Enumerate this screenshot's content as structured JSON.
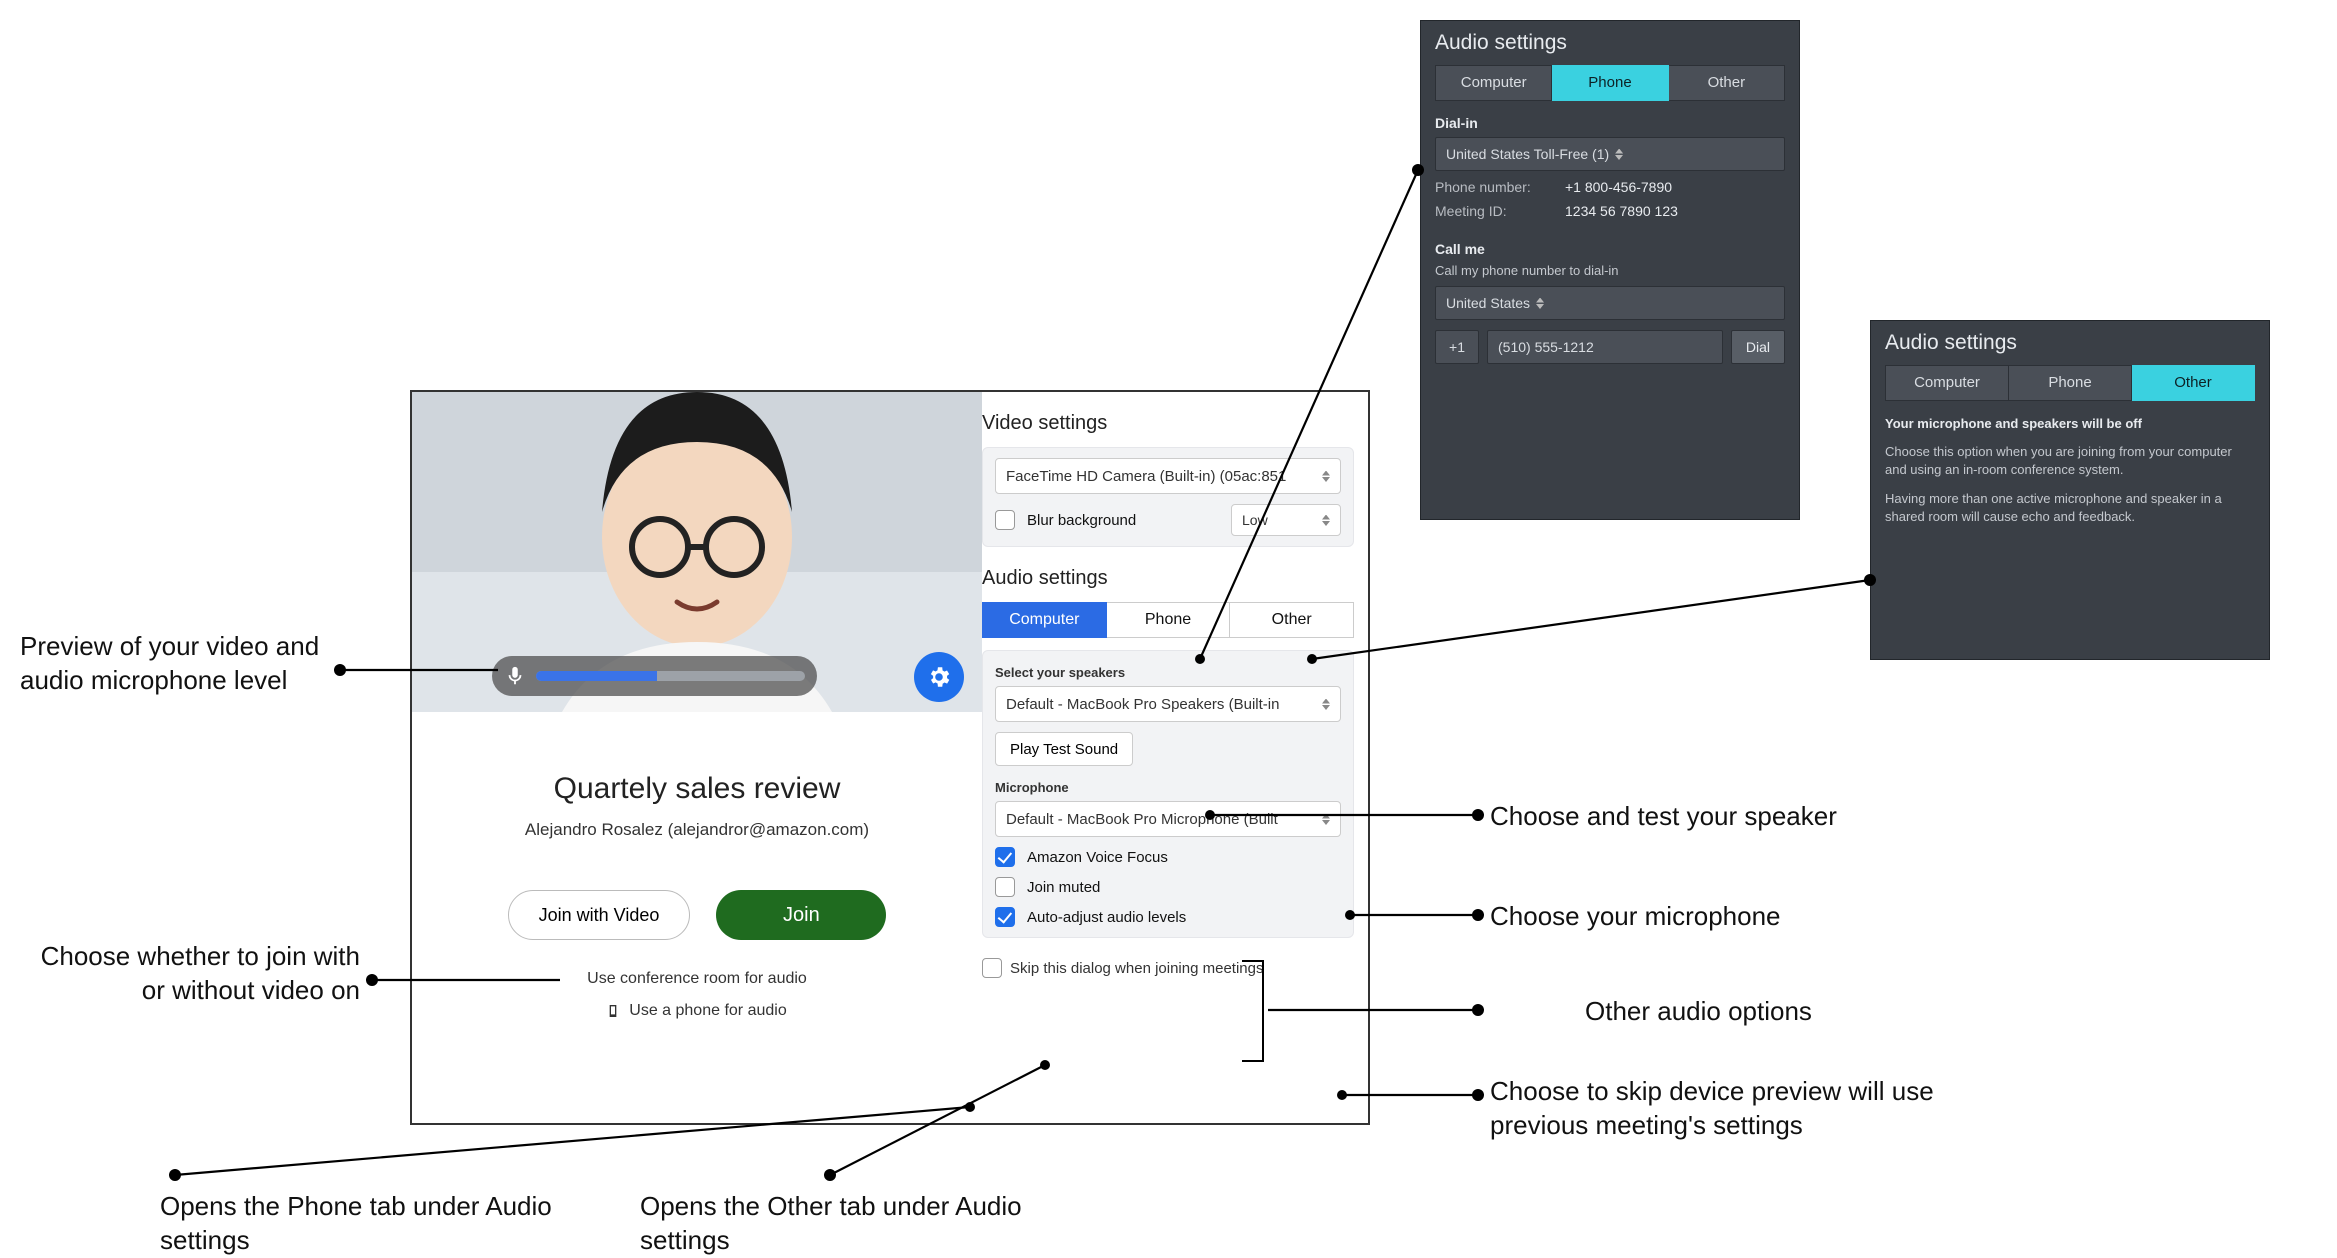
{
  "main": {
    "video_section": "Video settings",
    "camera_select": "FaceTime HD Camera (Built-in) (05ac:851",
    "blur_label": "Blur background",
    "blur_level": "Low",
    "audio_section": "Audio settings",
    "tabs": {
      "computer": "Computer",
      "phone": "Phone",
      "other": "Other"
    },
    "speakers_label": "Select your speakers",
    "speaker_select": "Default - MacBook Pro Speakers (Built-in",
    "test_sound": "Play Test Sound",
    "mic_label": "Microphone",
    "mic_select": "Default - MacBook Pro Microphone (Built",
    "opt_voice_focus": "Amazon Voice Focus",
    "opt_muted": "Join muted",
    "opt_auto": "Auto-adjust audio levels",
    "skip": "Skip this dialog when joining meetings",
    "meeting_title": "Quartely sales review",
    "meeting_sub": "Alejandro Rosalez (alejandror@amazon.com)",
    "join_video": "Join with Video",
    "join": "Join",
    "conf_room": "Use conference room for audio",
    "phone_audio": "Use a phone for audio"
  },
  "dark_phone": {
    "title": "Audio settings",
    "tabs": {
      "computer": "Computer",
      "phone": "Phone",
      "other": "Other"
    },
    "dialin_h": "Dial-in",
    "country": "United States Toll-Free (1)",
    "phone_k": "Phone number:",
    "phone_v": "+1 800-456-7890",
    "mid_k": "Meeting ID:",
    "mid_v": "1234 56 7890 123",
    "callme_h": "Call me",
    "callme_sub": "Call my phone number to dial-in",
    "callme_country": "United States",
    "cc": "+1",
    "callme_num": "(510) 555-1212",
    "dial": "Dial"
  },
  "dark_other": {
    "title": "Audio settings",
    "tabs": {
      "computer": "Computer",
      "phone": "Phone",
      "other": "Other"
    },
    "bold": "Your microphone and speakers will be off",
    "p1": "Choose this option when you are joining from your computer and using an in-room conference system.",
    "p2": "Having more than one active microphone and speaker in a shared room will cause echo and feedback."
  },
  "callouts": {
    "preview": "Preview of your video and audio microphone level",
    "join_choice": "Choose whether to join with or without video on",
    "phone_tab": "Opens the Phone tab under Audio settings",
    "other_tab": "Opens the Other tab under Audio settings",
    "speaker": "Choose and test your speaker",
    "mic": "Choose your microphone",
    "opts": "Other audio options",
    "skip": "Choose to skip device preview will use previous meeting's settings"
  }
}
